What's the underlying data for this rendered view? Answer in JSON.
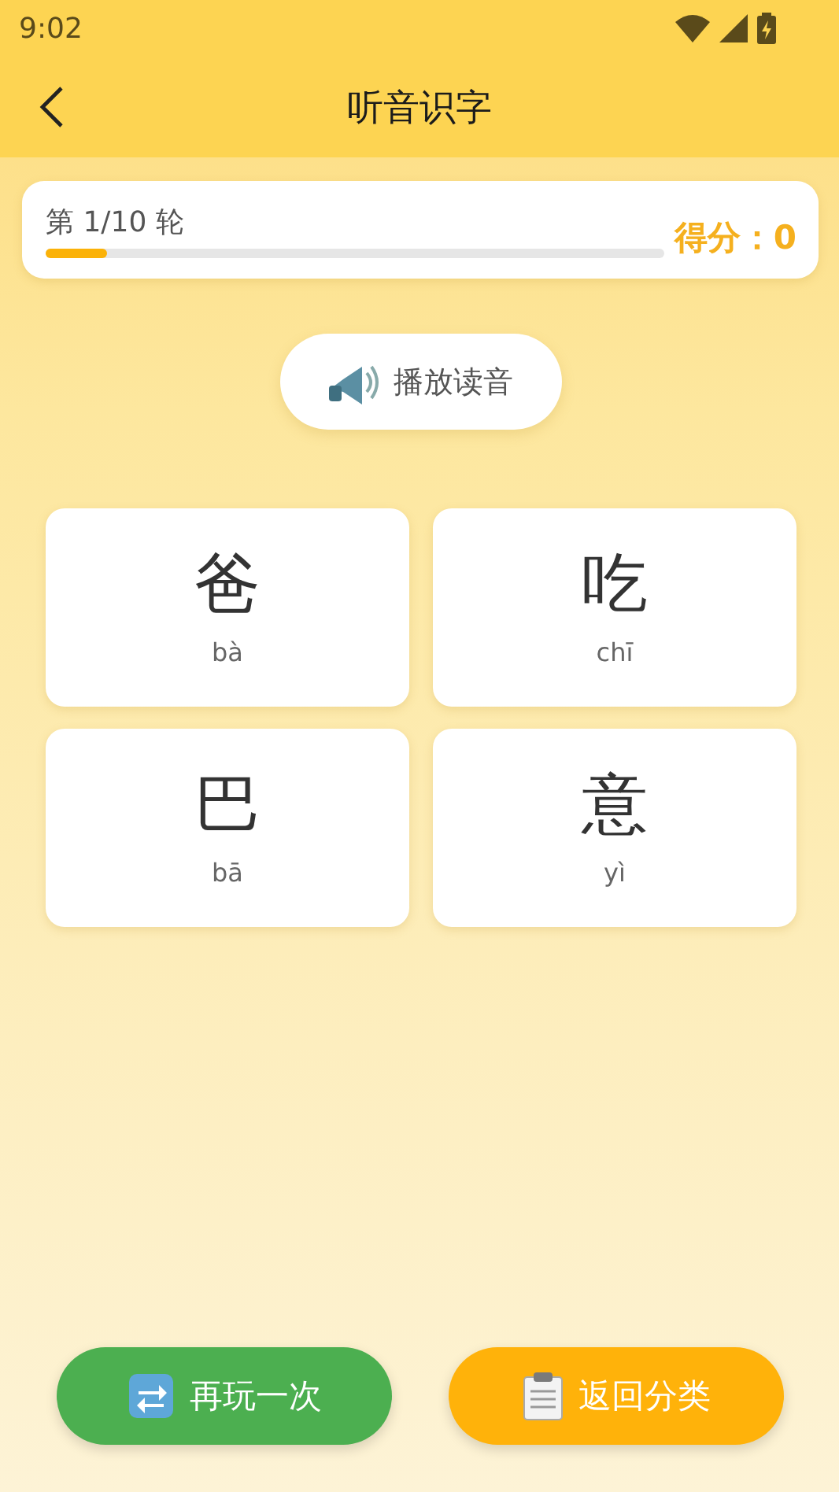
{
  "status_bar": {
    "time": "9:02"
  },
  "header": {
    "title": "听音识字"
  },
  "round": {
    "label": "第 1/10 轮",
    "level": 0.1,
    "score": "得分：0"
  },
  "play_button": {
    "label": "播放读音"
  },
  "options": [
    {
      "character": "爸",
      "pinyin": "bà"
    },
    {
      "character": "吃",
      "pinyin": "chī"
    },
    {
      "character": "巴",
      "pinyin": "bā"
    },
    {
      "character": "意",
      "pinyin": "yì"
    }
  ],
  "buttons": [
    {
      "kind": "replay",
      "label": "再玩一次"
    },
    {
      "kind": "back",
      "label": "返回分类"
    }
  ]
}
